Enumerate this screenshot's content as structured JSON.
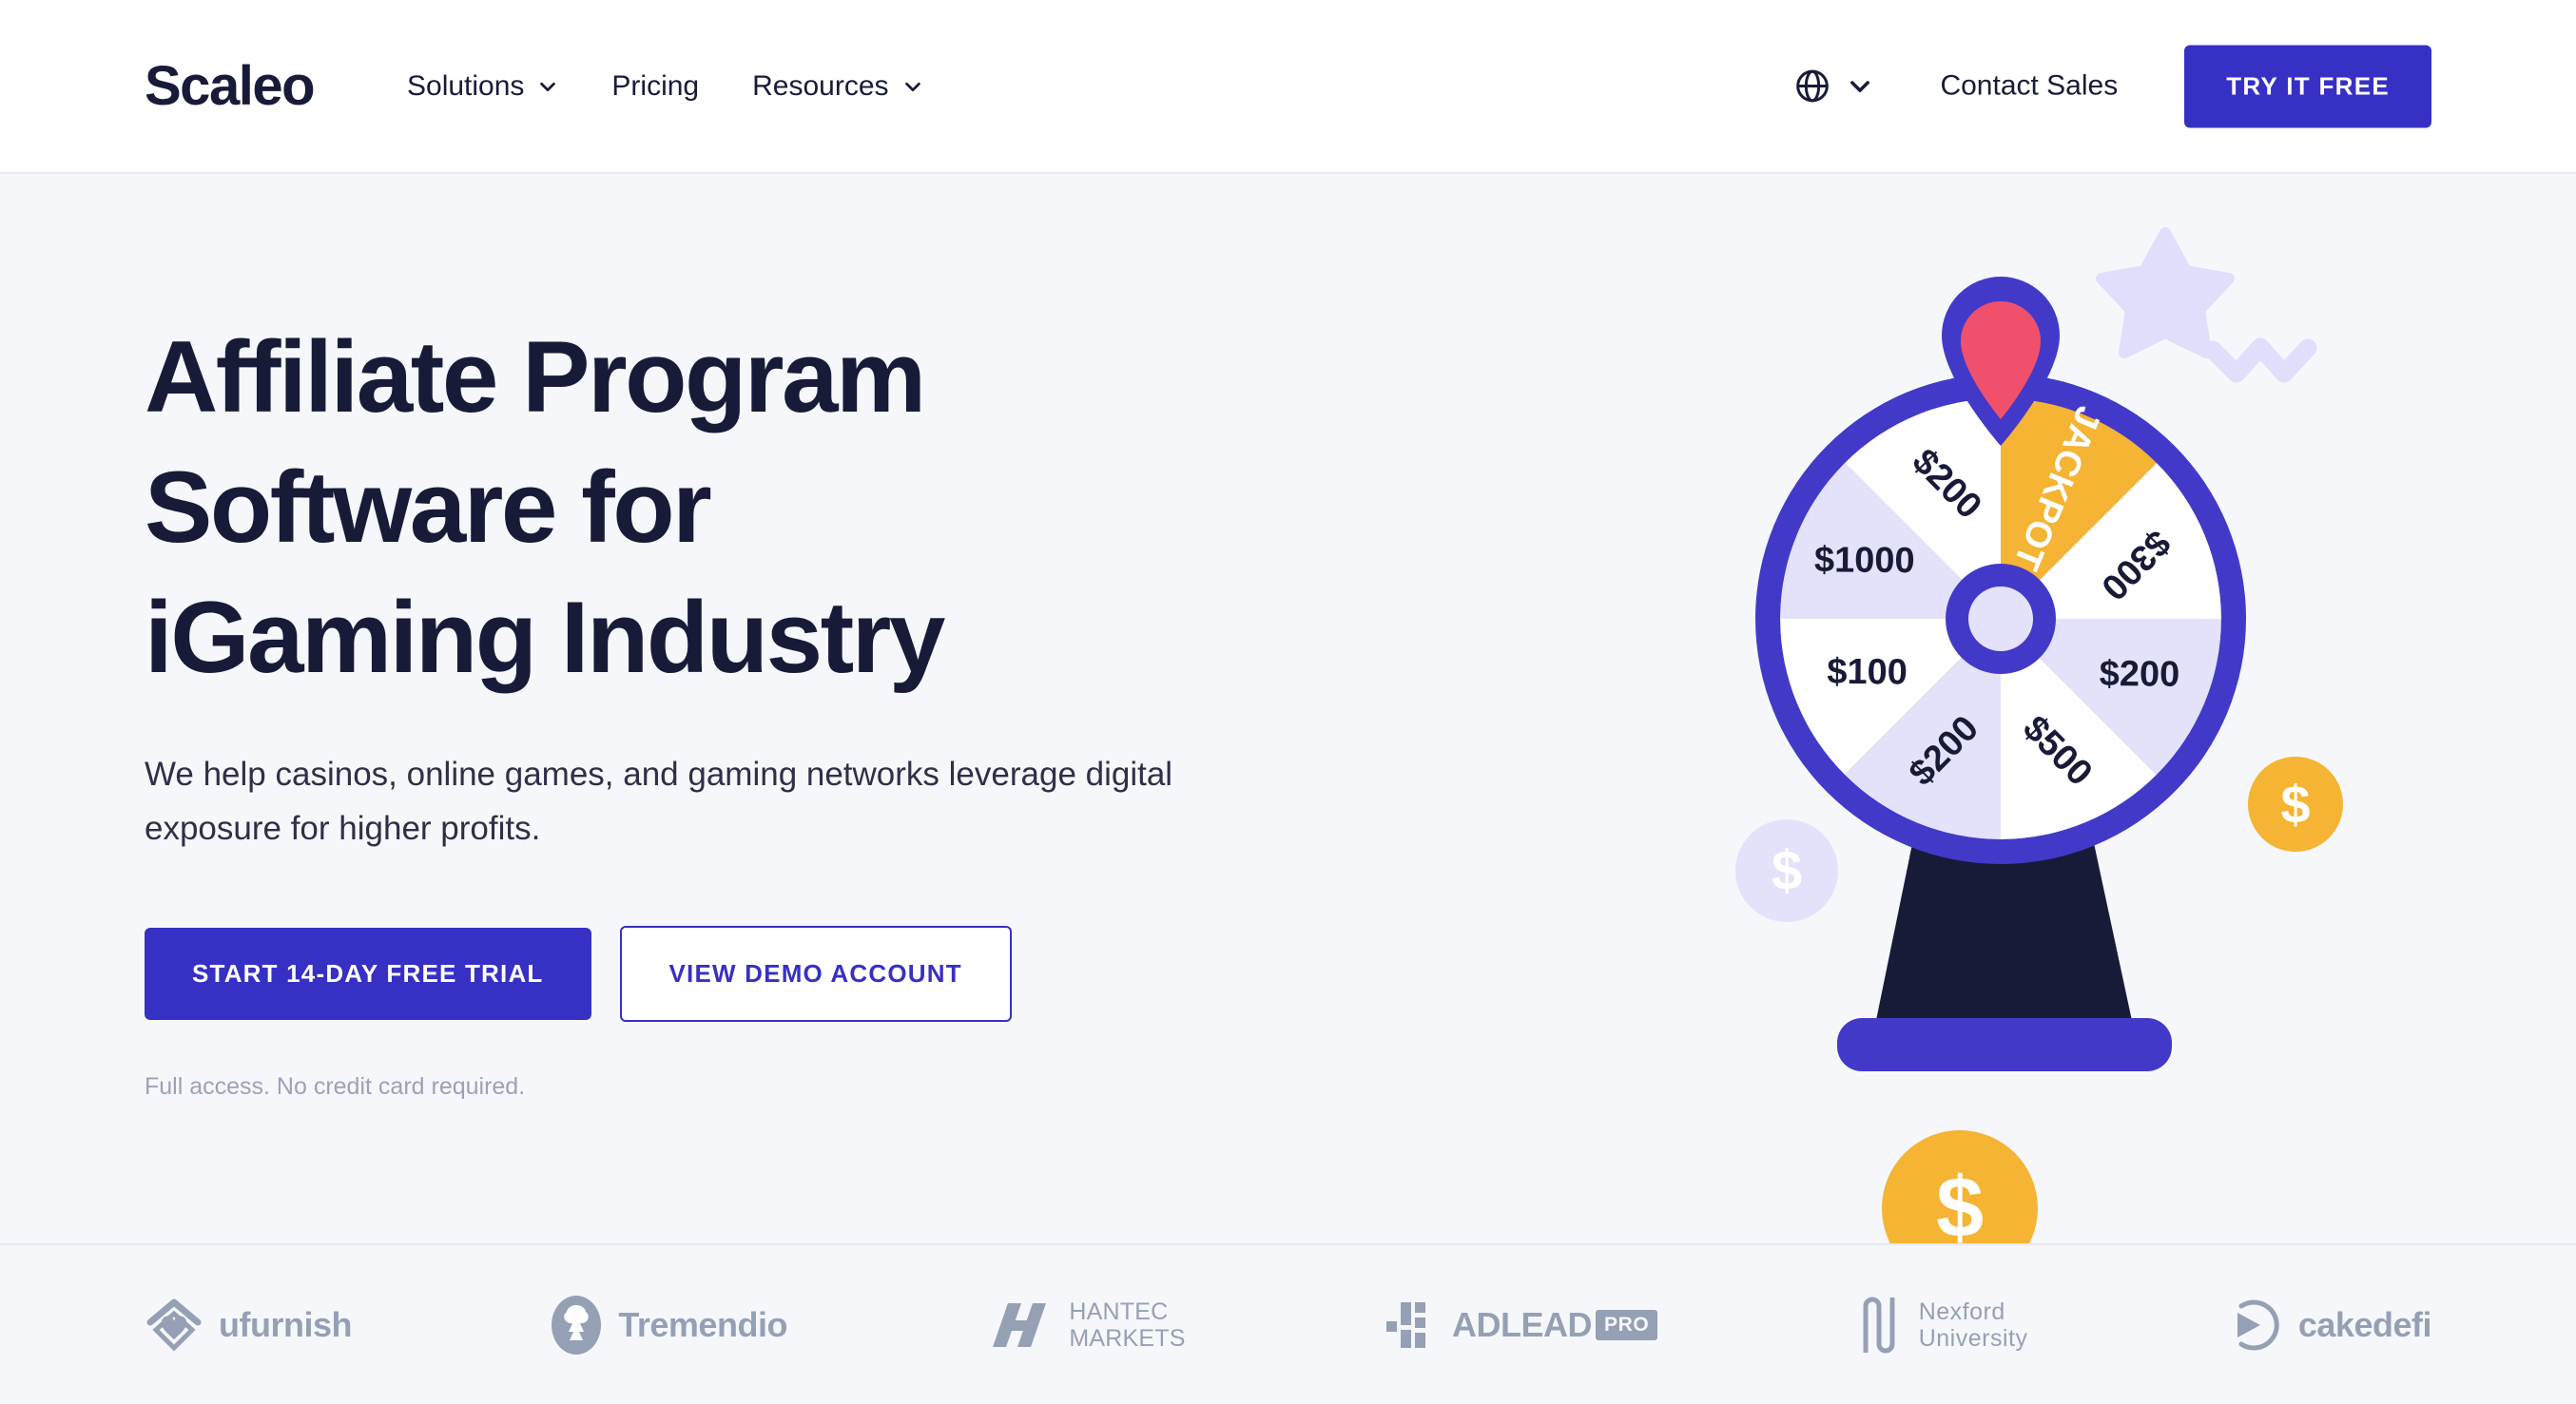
{
  "brand": {
    "name": "Scaleo",
    "accent": "#3730C4",
    "dark": "#181B38",
    "gold": "#F5B433",
    "red": "#F0506B",
    "lavender": "#E4E2FB",
    "page_bg": "#F6F7FB"
  },
  "header": {
    "nav": [
      {
        "label": "Solutions",
        "has_dropdown": true
      },
      {
        "label": "Pricing",
        "has_dropdown": false
      },
      {
        "label": "Resources",
        "has_dropdown": true
      }
    ],
    "language_icon": "globe-icon",
    "language_chevron": "chevron-down-icon",
    "contact_sales": "Contact Sales",
    "cta": "TRY IT FREE"
  },
  "hero": {
    "title_line1": "Affiliate Program",
    "title_line2": "Software for",
    "title_line3": "iGaming Industry",
    "subtitle": "We help casinos, online games, and gaming networks leverage digital exposure for higher profits.",
    "primary_cta": "START 14-DAY FREE TRIAL",
    "secondary_cta": "VIEW DEMO ACCOUNT",
    "note": "Full access. No credit card required."
  },
  "wheel": {
    "segments": [
      {
        "label": "JACKPOT",
        "fill": "#F5B433",
        "text_color": "#FFFFFF"
      },
      {
        "label": "$300",
        "fill": "#FFFFFF",
        "text_color": "#181B38"
      },
      {
        "label": "$200",
        "fill": "#E4E2FB",
        "text_color": "#181B38"
      },
      {
        "label": "$500",
        "fill": "#FFFFFF",
        "text_color": "#181B38"
      },
      {
        "label": "$200",
        "fill": "#E4E2FB",
        "text_color": "#181B38"
      },
      {
        "label": "$100",
        "fill": "#FFFFFF",
        "text_color": "#181B38"
      },
      {
        "label": "$1000",
        "fill": "#E4E2FB",
        "text_color": "#181B38"
      },
      {
        "label": "$200",
        "fill": "#FFFFFF",
        "text_color": "#181B38"
      }
    ],
    "pointer_color": "#F0506B",
    "rim_color": "#3F37C9",
    "hub_color": "#3F37C9",
    "stand_color": "#181B38",
    "base_color": "#4339C9",
    "coin_symbol": "$",
    "coin_gold_color": "#F5B433",
    "coin_ghost_color": "#E4E2FB",
    "star_color": "#E0DEFB",
    "zigzag_color": "#E0DEFB"
  },
  "clients": [
    {
      "name": "ufurnish",
      "mark": "house-heart-icon",
      "style": "bold"
    },
    {
      "name": "Tremendio",
      "mark": "tree-oval-icon",
      "style": "bold"
    },
    {
      "name": "HANTEC\nMARKETS",
      "line1": "HANTEC",
      "line2": "MARKETS",
      "mark": "hantec-slash-icon",
      "style": "two-line"
    },
    {
      "name": "ADLEAD",
      "badge": "PRO",
      "mark": "adlead-bars-icon",
      "style": "bold-badge"
    },
    {
      "name": "Nexford\nUniversity",
      "line1": "Nexford",
      "line2": "University",
      "mark": "nexford-n-icon",
      "style": "two-line"
    },
    {
      "name": "cakedefi",
      "mark": "cakedefi-play-icon",
      "style": "bold"
    }
  ]
}
